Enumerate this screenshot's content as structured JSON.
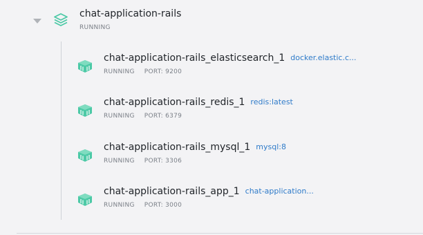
{
  "group": {
    "name": "chat-application-rails",
    "status": "RUNNING",
    "icon": "stack-icon",
    "expanded": true,
    "accent": "#4cc9a6"
  },
  "containers": [
    {
      "name": "chat-application-rails_elasticsearch_1",
      "image": "docker.elastic.c...",
      "status": "RUNNING",
      "port": "PORT: 9200",
      "icon": "container-icon"
    },
    {
      "name": "chat-application-rails_redis_1",
      "image": "redis:latest",
      "status": "RUNNING",
      "port": "PORT: 6379",
      "icon": "container-icon"
    },
    {
      "name": "chat-application-rails_mysql_1",
      "image": "mysql:8",
      "status": "RUNNING",
      "port": "PORT: 3306",
      "icon": "container-icon"
    },
    {
      "name": "chat-application-rails_app_1",
      "image": "chat-application...",
      "status": "RUNNING",
      "port": "PORT: 3000",
      "icon": "container-icon"
    }
  ],
  "colors": {
    "background": "#f3f3f5",
    "text": "#1f2328",
    "muted": "#7a7f87",
    "link": "#2f7bc9",
    "accent": "#4cc9a6"
  }
}
